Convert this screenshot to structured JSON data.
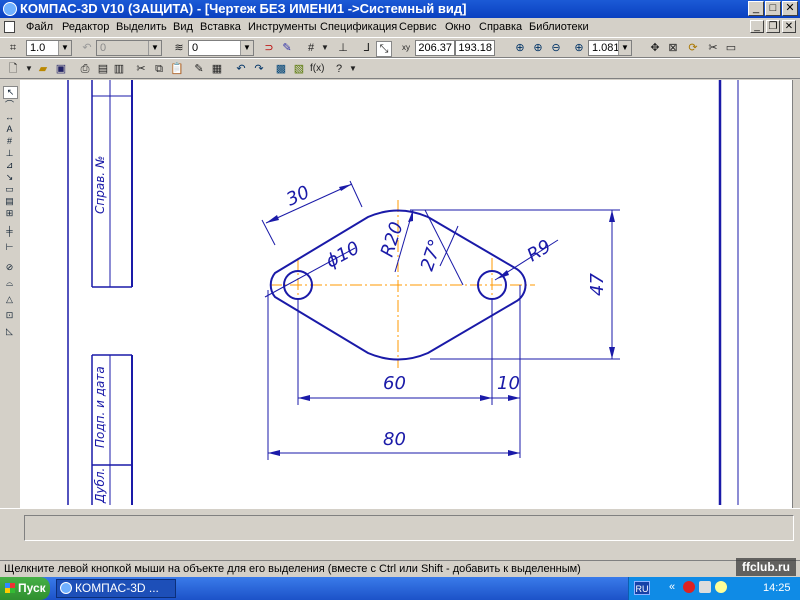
{
  "window": {
    "title": "КОМПАС-3D V10 (ЗАЩИТА) - [Чертеж БЕЗ ИМЕНИ1 ->Системный вид]",
    "min": "_",
    "max": "□",
    "close": "✕"
  },
  "menu": {
    "items": [
      "Файл",
      "Редактор",
      "Выделить",
      "Вид",
      "Вставка",
      "Инструменты",
      "Спецификация",
      "Сервис",
      "Окно",
      "Справка",
      "Библиотеки"
    ]
  },
  "toolbar1": {
    "step": "1.0",
    "angle": "0",
    "layer": "0",
    "x": "206.37",
    "y": "193.18",
    "zoom": "1.0812"
  },
  "stamp": {
    "sprav": "Справ. №",
    "podp": "Подп. и дата",
    "dubl": "Дубл."
  },
  "drawing": {
    "dim_30": "30",
    "dim_d10": "ϕ10",
    "dim_r20": "R20",
    "dim_27": "27°",
    "dim_r9": "R9",
    "dim_47": "47",
    "dim_60": "60",
    "dim_10": "10",
    "dim_80": "80"
  },
  "status": {
    "text": "Щелкните левой кнопкой мыши на объекте для его выделения (вместе с Ctrl или Shift - добавить к выделенным)"
  },
  "taskbar": {
    "start": "Пуск",
    "task": "КОМПАС-3D ...",
    "lang": "RU",
    "clock": "14:25"
  },
  "watermark": "ffclub.ru",
  "colors": {
    "line": "#1a1aa8",
    "axis": "#ff9900",
    "titlebar": "#0a40c0"
  }
}
